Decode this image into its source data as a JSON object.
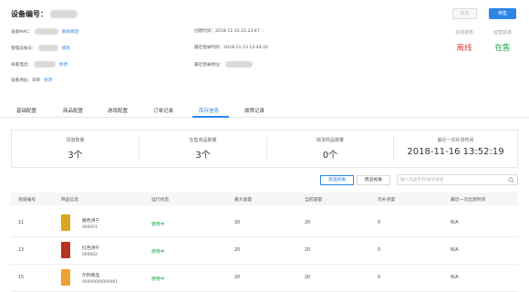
{
  "header": {
    "device_label": "设备编号：",
    "btn_disabled": "启用",
    "btn_primary": "停售"
  },
  "info": {
    "mac_label": "设备MAC：",
    "mac_link": "解除绑定",
    "manager_label": "管理员账号：",
    "manager_link": "修改",
    "owner_phone_label": "商家电话：",
    "owner_phone_link": "修改",
    "address_label": "设备地址：",
    "address_value": "深圳",
    "address_link": "修改",
    "create_time_label": "创建时间：",
    "create_time_value": "2018-11-15 21:23:47",
    "last_login_label": "最近登录时间：",
    "last_login_value": "2018-11-13 13:44:20",
    "last_login_addr_label": "最近登录地址："
  },
  "status": {
    "online_caption": "在线状态",
    "online_value": "离线",
    "op_caption": "运营状态",
    "op_value": "在售"
  },
  "tabs": [
    {
      "label": "基础配置"
    },
    {
      "label": "商品配置"
    },
    {
      "label": "游戏配置"
    },
    {
      "label": "订单记录"
    },
    {
      "label": "库存信息"
    },
    {
      "label": "故障记录"
    }
  ],
  "stats": [
    {
      "caption": "货道数量",
      "value": "3个"
    },
    {
      "caption": "在售商品数量",
      "value": "3个"
    },
    {
      "caption": "缺货商品数量",
      "value": "0个"
    },
    {
      "caption": "最近一次补货时间",
      "value": "2018-11-16 13:52:19"
    }
  ],
  "toggle": {
    "view_channel": "货道视角",
    "view_product": "商品视角"
  },
  "search": {
    "placeholder": "输入商品名称/编号搜索"
  },
  "table": {
    "headers": [
      "货道编号",
      "商品信息",
      "运行状态",
      "最大容量",
      "当前容量",
      "可补货量",
      "最近一次出货时间"
    ],
    "rows": [
      {
        "channel": "11",
        "name": "藤色饼干",
        "code": "000001",
        "status": "使用中",
        "max": "20",
        "current": "20",
        "restock": "0",
        "last": "N/A",
        "thumb_color": "#d9a520"
      },
      {
        "channel": "13",
        "name": "红色饼干",
        "code": "000002",
        "status": "使用中",
        "max": "20",
        "current": "20",
        "restock": "0",
        "last": "N/A",
        "thumb_color": "#b8321f"
      },
      {
        "channel": "15",
        "name": "示例商品",
        "code": "00000000000001",
        "status": "使用中",
        "max": "20",
        "current": "20",
        "restock": "0",
        "last": "N/A",
        "thumb_color": "#f0a030"
      }
    ]
  },
  "colors": {
    "accent": "#2d86e6",
    "offline": "#e0393e",
    "online": "#17a34a"
  }
}
